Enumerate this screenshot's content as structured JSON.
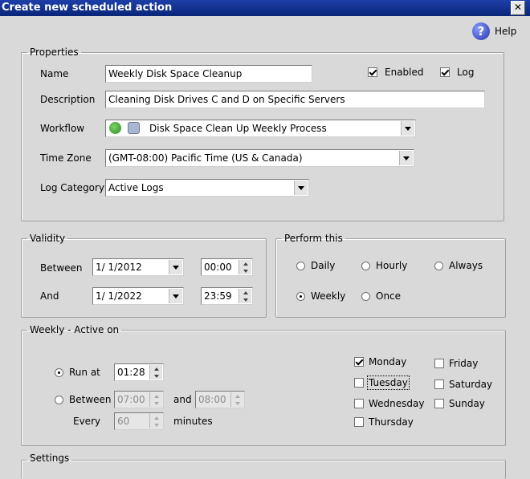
{
  "window": {
    "title": "Create new scheduled action"
  },
  "help": {
    "label": "Help"
  },
  "properties": {
    "legend": "Properties",
    "name_label": "Name",
    "name_value": "Weekly Disk Space Cleanup",
    "description_label": "Description",
    "description_value": "Cleaning Disk Drives C and D on Specific Servers",
    "workflow_label": "Workflow",
    "workflow_value": "Disk Space Clean Up Weekly Process",
    "timezone_label": "Time Zone",
    "timezone_value": "(GMT-08:00) Pacific Time (US & Canada)",
    "logcategory_label": "Log Category",
    "logcategory_value": "Active Logs",
    "enabled_label": "Enabled",
    "enabled_checked": true,
    "log_label": "Log",
    "log_checked": true
  },
  "validity": {
    "legend": "Validity",
    "between_label": "Between",
    "between_date": "1/  1/2012",
    "between_time": "00:00",
    "and_label": "And",
    "and_date": "1/  1/2022",
    "and_time": "23:59"
  },
  "perform": {
    "legend": "Perform this",
    "options": [
      "Daily",
      "Hourly",
      "Always",
      "Weekly",
      "Once"
    ],
    "selected": "Weekly"
  },
  "weekly": {
    "legend": "Weekly - Active on",
    "run_at_label": "Run at",
    "run_at_value": "01:28",
    "between_label": "Between",
    "between_from": "07:00",
    "and_label": "and",
    "between_to": "08:00",
    "every_label": "Every",
    "every_value": "60",
    "minutes_label": "minutes",
    "days": [
      "Monday",
      "Tuesday",
      "Wednesday",
      "Thursday",
      "Friday",
      "Saturday",
      "Sunday"
    ],
    "checked_days": [
      "Monday"
    ]
  },
  "settings": {
    "legend": "Settings"
  }
}
